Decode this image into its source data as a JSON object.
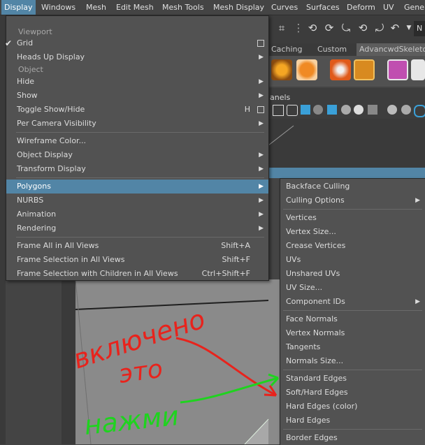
{
  "menubar": {
    "items": [
      {
        "label": "Display"
      },
      {
        "label": "Windows"
      },
      {
        "label": "Mesh"
      },
      {
        "label": "Edit Mesh"
      },
      {
        "label": "Mesh Tools"
      },
      {
        "label": "Mesh Display"
      },
      {
        "label": "Curves"
      },
      {
        "label": "Surfaces"
      },
      {
        "label": "Deform"
      },
      {
        "label": "UV"
      },
      {
        "label": "Gener"
      }
    ]
  },
  "toolbar": {
    "field_text": "N"
  },
  "shelf": {
    "tabs": [
      {
        "label": "Caching"
      },
      {
        "label": "Custom"
      },
      {
        "label": "AdvancwdSkeleto"
      }
    ]
  },
  "panel": {
    "label": "anels"
  },
  "display_menu": {
    "viewport_header": "Viewport",
    "object_header": "Object",
    "items": [
      {
        "label": "Grid",
        "checked": "✔"
      },
      {
        "label": "Heads Up Display"
      },
      {
        "label": "Hide"
      },
      {
        "label": "Show"
      },
      {
        "label": "Toggle Show/Hide",
        "shortcut": "H"
      },
      {
        "label": "Per Camera Visibility"
      },
      {
        "label": "Wireframe Color..."
      },
      {
        "label": "Object Display"
      },
      {
        "label": "Transform Display"
      },
      {
        "label": "Polygons"
      },
      {
        "label": "NURBS"
      },
      {
        "label": "Animation"
      },
      {
        "label": "Rendering"
      },
      {
        "label": "Frame All in All Views",
        "shortcut": "Shift+A"
      },
      {
        "label": "Frame Selection in All Views",
        "shortcut": "Shift+F"
      },
      {
        "label": "Frame Selection with Children in All Views",
        "shortcut": "Ctrl+Shift+F"
      }
    ]
  },
  "polygons_submenu": {
    "items": [
      {
        "label": "Backface Culling"
      },
      {
        "label": "Culling Options"
      },
      {
        "label": "Vertices"
      },
      {
        "label": "Vertex Size..."
      },
      {
        "label": "Crease Vertices"
      },
      {
        "label": "UVs"
      },
      {
        "label": "Unshared UVs"
      },
      {
        "label": "UV Size..."
      },
      {
        "label": "Component IDs"
      },
      {
        "label": "Face Normals"
      },
      {
        "label": "Vertex Normals"
      },
      {
        "label": "Tangents"
      },
      {
        "label": "Normals Size..."
      },
      {
        "label": "Standard Edges"
      },
      {
        "label": "Soft/Hard Edges"
      },
      {
        "label": "Hard Edges (color)"
      },
      {
        "label": "Hard Edges"
      },
      {
        "label": "Border Edges"
      }
    ]
  },
  "annotations": {
    "red_text_1": "включено",
    "red_text_2": "это",
    "green_text": "нажми",
    "red_color": "#e8231c",
    "green_color": "#1fd31f"
  },
  "colors": {
    "highlight": "#5285a6",
    "menu_bg": "#525252",
    "app_bg": "#444444"
  }
}
